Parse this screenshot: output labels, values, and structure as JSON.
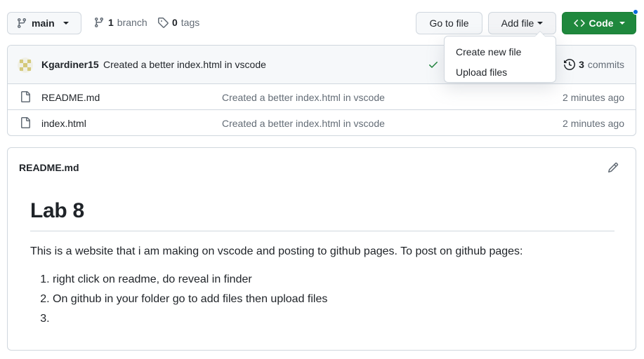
{
  "toolbar": {
    "branch_name": "main",
    "branch_count": "1",
    "branch_label": "branch",
    "tag_count": "0",
    "tag_label": "tags",
    "go_to_file": "Go to file",
    "add_file": "Add file",
    "code": "Code"
  },
  "dropdown": {
    "items": [
      {
        "label": "Create new file"
      },
      {
        "label": "Upload files"
      }
    ]
  },
  "latest_commit": {
    "author": "Kgardiner15",
    "message": "Created a better index.html in vscode",
    "commit_count": "3",
    "commit_label": "commits",
    "status_color": "#1a7f37"
  },
  "files": [
    {
      "name": "README.md",
      "commit": "Created a better index.html in vscode",
      "age": "2 minutes ago"
    },
    {
      "name": "index.html",
      "commit": "Created a better index.html in vscode",
      "age": "2 minutes ago"
    }
  ],
  "readme": {
    "filename": "README.md",
    "heading": "Lab 8",
    "paragraph": "This is a website that i am making on vscode and posting to github pages. To post on github pages:",
    "list": [
      {
        "text": "right click on readme, do reveal in finder"
      },
      {
        "text": "On github in your folder go to add files then upload files"
      },
      {
        "text": ""
      }
    ]
  },
  "colors": {
    "accent_green": "#1f883d",
    "notification_blue": "#0969da",
    "border": "#d0d7de"
  }
}
